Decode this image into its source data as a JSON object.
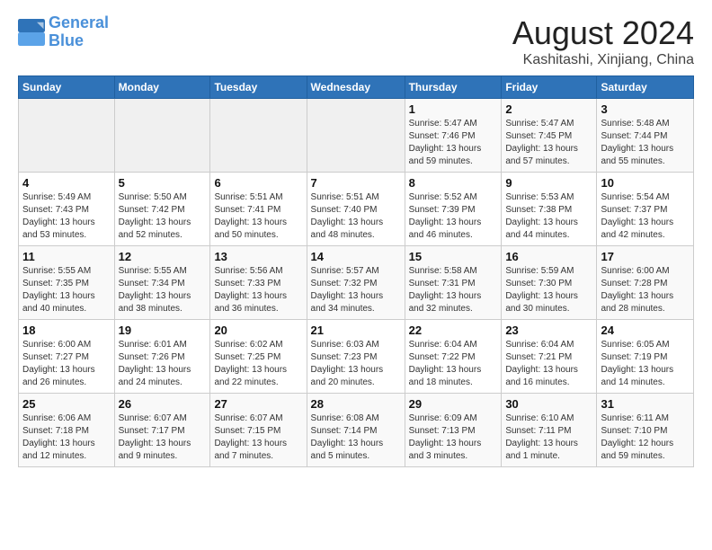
{
  "logo": {
    "text_general": "General",
    "text_blue": "Blue"
  },
  "header": {
    "month_year": "August 2024",
    "location": "Kashitashi, Xinjiang, China"
  },
  "days_of_week": [
    "Sunday",
    "Monday",
    "Tuesday",
    "Wednesday",
    "Thursday",
    "Friday",
    "Saturday"
  ],
  "weeks": [
    [
      {
        "day": "",
        "info": ""
      },
      {
        "day": "",
        "info": ""
      },
      {
        "day": "",
        "info": ""
      },
      {
        "day": "",
        "info": ""
      },
      {
        "day": "1",
        "info": "Sunrise: 5:47 AM\nSunset: 7:46 PM\nDaylight: 13 hours\nand 59 minutes."
      },
      {
        "day": "2",
        "info": "Sunrise: 5:47 AM\nSunset: 7:45 PM\nDaylight: 13 hours\nand 57 minutes."
      },
      {
        "day": "3",
        "info": "Sunrise: 5:48 AM\nSunset: 7:44 PM\nDaylight: 13 hours\nand 55 minutes."
      }
    ],
    [
      {
        "day": "4",
        "info": "Sunrise: 5:49 AM\nSunset: 7:43 PM\nDaylight: 13 hours\nand 53 minutes."
      },
      {
        "day": "5",
        "info": "Sunrise: 5:50 AM\nSunset: 7:42 PM\nDaylight: 13 hours\nand 52 minutes."
      },
      {
        "day": "6",
        "info": "Sunrise: 5:51 AM\nSunset: 7:41 PM\nDaylight: 13 hours\nand 50 minutes."
      },
      {
        "day": "7",
        "info": "Sunrise: 5:51 AM\nSunset: 7:40 PM\nDaylight: 13 hours\nand 48 minutes."
      },
      {
        "day": "8",
        "info": "Sunrise: 5:52 AM\nSunset: 7:39 PM\nDaylight: 13 hours\nand 46 minutes."
      },
      {
        "day": "9",
        "info": "Sunrise: 5:53 AM\nSunset: 7:38 PM\nDaylight: 13 hours\nand 44 minutes."
      },
      {
        "day": "10",
        "info": "Sunrise: 5:54 AM\nSunset: 7:37 PM\nDaylight: 13 hours\nand 42 minutes."
      }
    ],
    [
      {
        "day": "11",
        "info": "Sunrise: 5:55 AM\nSunset: 7:35 PM\nDaylight: 13 hours\nand 40 minutes."
      },
      {
        "day": "12",
        "info": "Sunrise: 5:55 AM\nSunset: 7:34 PM\nDaylight: 13 hours\nand 38 minutes."
      },
      {
        "day": "13",
        "info": "Sunrise: 5:56 AM\nSunset: 7:33 PM\nDaylight: 13 hours\nand 36 minutes."
      },
      {
        "day": "14",
        "info": "Sunrise: 5:57 AM\nSunset: 7:32 PM\nDaylight: 13 hours\nand 34 minutes."
      },
      {
        "day": "15",
        "info": "Sunrise: 5:58 AM\nSunset: 7:31 PM\nDaylight: 13 hours\nand 32 minutes."
      },
      {
        "day": "16",
        "info": "Sunrise: 5:59 AM\nSunset: 7:30 PM\nDaylight: 13 hours\nand 30 minutes."
      },
      {
        "day": "17",
        "info": "Sunrise: 6:00 AM\nSunset: 7:28 PM\nDaylight: 13 hours\nand 28 minutes."
      }
    ],
    [
      {
        "day": "18",
        "info": "Sunrise: 6:00 AM\nSunset: 7:27 PM\nDaylight: 13 hours\nand 26 minutes."
      },
      {
        "day": "19",
        "info": "Sunrise: 6:01 AM\nSunset: 7:26 PM\nDaylight: 13 hours\nand 24 minutes."
      },
      {
        "day": "20",
        "info": "Sunrise: 6:02 AM\nSunset: 7:25 PM\nDaylight: 13 hours\nand 22 minutes."
      },
      {
        "day": "21",
        "info": "Sunrise: 6:03 AM\nSunset: 7:23 PM\nDaylight: 13 hours\nand 20 minutes."
      },
      {
        "day": "22",
        "info": "Sunrise: 6:04 AM\nSunset: 7:22 PM\nDaylight: 13 hours\nand 18 minutes."
      },
      {
        "day": "23",
        "info": "Sunrise: 6:04 AM\nSunset: 7:21 PM\nDaylight: 13 hours\nand 16 minutes."
      },
      {
        "day": "24",
        "info": "Sunrise: 6:05 AM\nSunset: 7:19 PM\nDaylight: 13 hours\nand 14 minutes."
      }
    ],
    [
      {
        "day": "25",
        "info": "Sunrise: 6:06 AM\nSunset: 7:18 PM\nDaylight: 13 hours\nand 12 minutes."
      },
      {
        "day": "26",
        "info": "Sunrise: 6:07 AM\nSunset: 7:17 PM\nDaylight: 13 hours\nand 9 minutes."
      },
      {
        "day": "27",
        "info": "Sunrise: 6:07 AM\nSunset: 7:15 PM\nDaylight: 13 hours\nand 7 minutes."
      },
      {
        "day": "28",
        "info": "Sunrise: 6:08 AM\nSunset: 7:14 PM\nDaylight: 13 hours\nand 5 minutes."
      },
      {
        "day": "29",
        "info": "Sunrise: 6:09 AM\nSunset: 7:13 PM\nDaylight: 13 hours\nand 3 minutes."
      },
      {
        "day": "30",
        "info": "Sunrise: 6:10 AM\nSunset: 7:11 PM\nDaylight: 13 hours\nand 1 minute."
      },
      {
        "day": "31",
        "info": "Sunrise: 6:11 AM\nSunset: 7:10 PM\nDaylight: 12 hours\nand 59 minutes."
      }
    ]
  ]
}
